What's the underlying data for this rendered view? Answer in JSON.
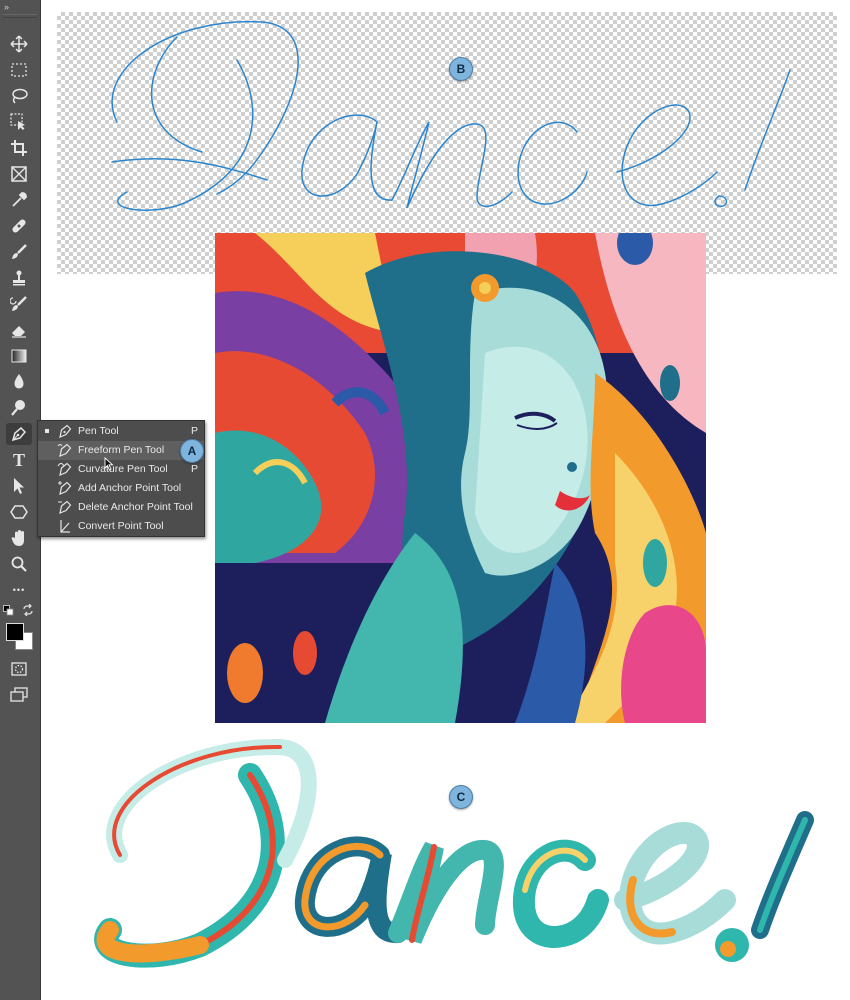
{
  "toolbar": {
    "collapse_glyph": "»",
    "tools": [
      "move-icon",
      "rect-marquee-icon",
      "lasso-icon",
      "object-select-icon",
      "crop-icon",
      "frame-icon",
      "eyedropper-icon",
      "healing-icon",
      "brush-icon",
      "stamp-icon",
      "history-brush-icon",
      "eraser-icon",
      "gradient-icon",
      "blur-icon",
      "dodge-icon",
      "pen-icon",
      "type-icon",
      "path-select-icon",
      "shape-icon",
      "hand-icon",
      "zoom-icon",
      "more-icon"
    ],
    "active_tool": "pen-icon",
    "type_glyph": "T",
    "more_glyph": "•••",
    "foreground_color": "#000000",
    "background_color": "#ffffff"
  },
  "flyout": {
    "items": [
      {
        "label": "Pen Tool",
        "shortcut": "P",
        "selected": true
      },
      {
        "label": "Freeform Pen Tool",
        "shortcut": "",
        "hover": true
      },
      {
        "label": "Curvature Pen Tool",
        "shortcut": "P"
      },
      {
        "label": "Add Anchor Point Tool",
        "shortcut": ""
      },
      {
        "label": "Delete Anchor Point Tool",
        "shortcut": ""
      },
      {
        "label": "Convert Point Tool",
        "shortcut": ""
      }
    ]
  },
  "callouts": {
    "a": "A",
    "b": "B",
    "c": "C"
  },
  "canvas": {
    "outline_word": "Dance!",
    "painted_word": "Dance!"
  },
  "colors": {
    "toolbar_bg": "#535353",
    "outline_stroke": "#2b86cf",
    "callout_fill": "#7fb4dd"
  }
}
